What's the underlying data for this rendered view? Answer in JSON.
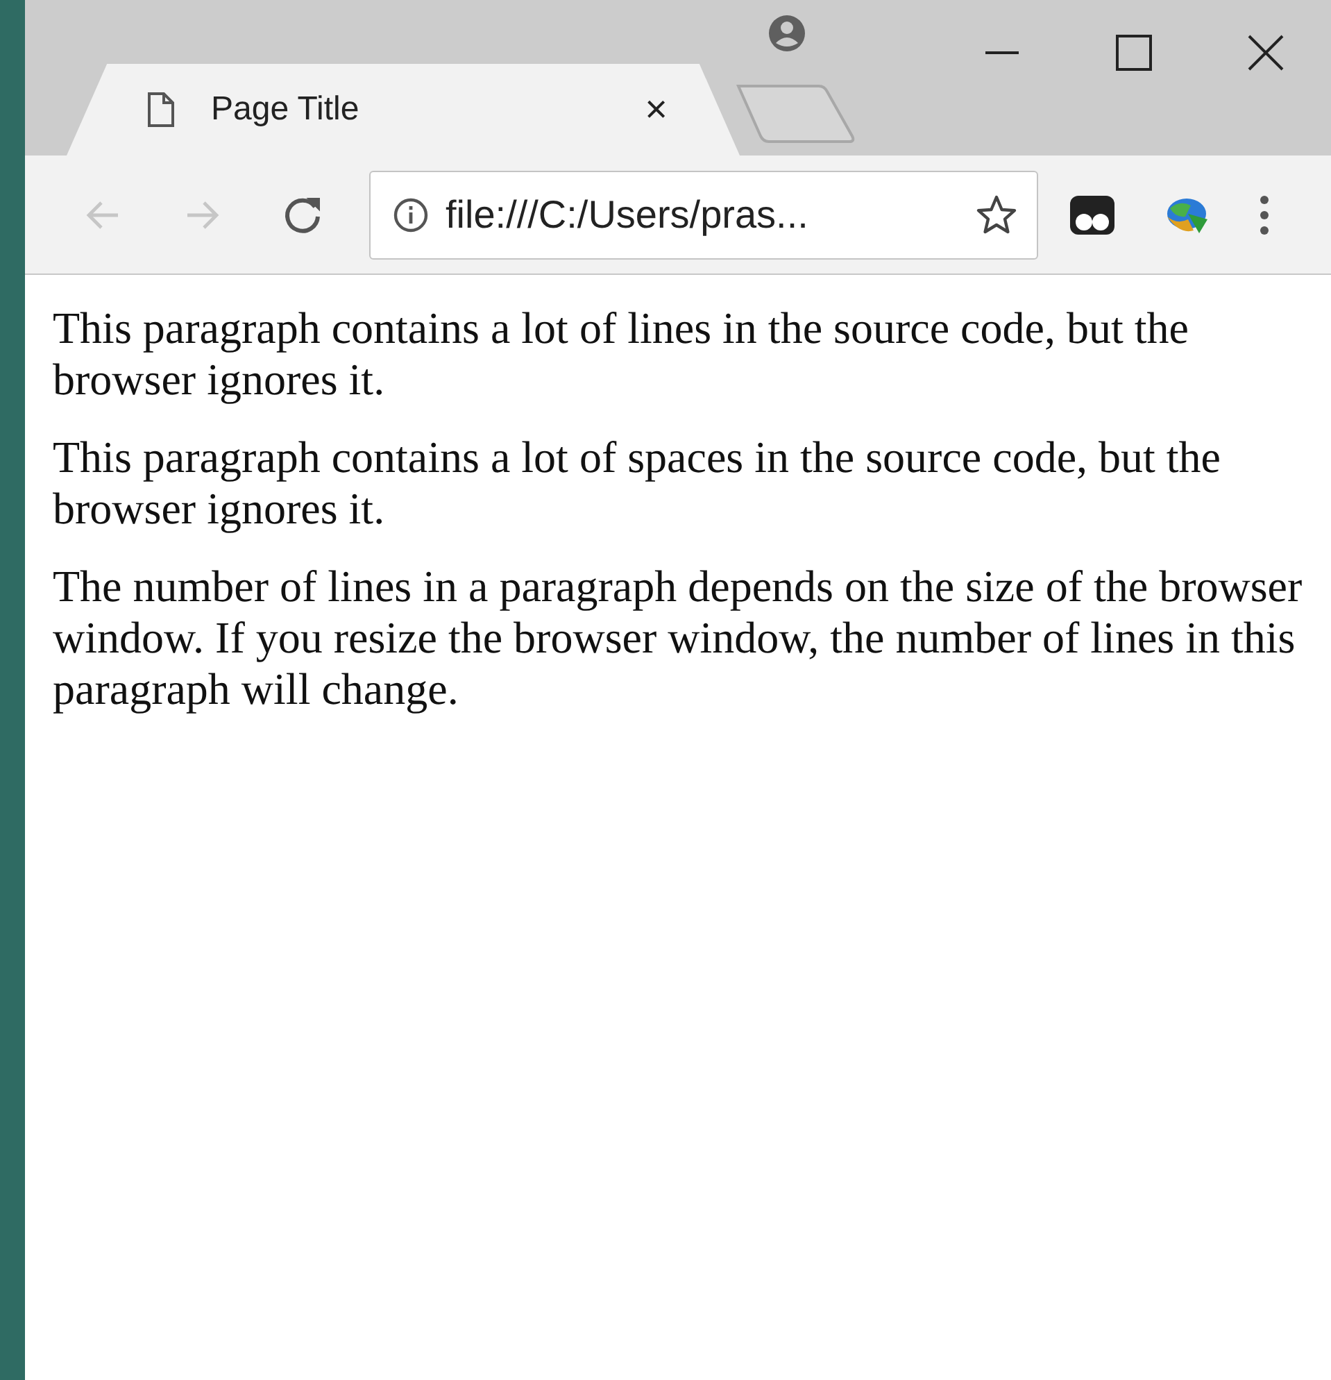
{
  "tabs": [
    {
      "title": "Page Title",
      "selected": true,
      "close": "×"
    }
  ],
  "nav_buttons": [
    {
      "kind": "back",
      "disabled": true
    },
    {
      "kind": "forward",
      "disabled": true
    },
    {
      "kind": "reload",
      "disabled": false
    }
  ],
  "address_bar": {
    "value": "file:///C:/Users/pras...",
    "bookmarked": false
  },
  "paragraphs": [
    "This paragraph contains a lot of lines in the source code, but the browser ignores it.",
    "This paragraph contains a lot of spaces in the source code, but the browser ignores it.",
    "The number of lines in a paragraph depends on the size of the browser window. If you resize the browser window, the number of lines in this paragraph will change."
  ]
}
